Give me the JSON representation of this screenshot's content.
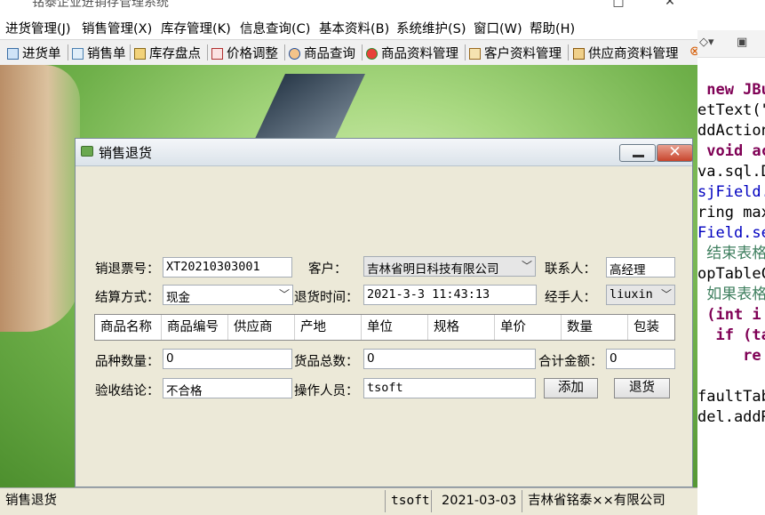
{
  "window": {
    "title": "铭泰企业进销存管理系统"
  },
  "menubar": {
    "items": [
      "进货管理(J)",
      "销售管理(X)",
      "库存管理(K)",
      "信息查询(C)",
      "基本资料(B)",
      "系统维护(S)",
      "窗口(W)",
      "帮助(H)"
    ]
  },
  "toolbar": {
    "items": [
      {
        "label": "进货单",
        "icon": "purchase-icon"
      },
      {
        "label": "销售单",
        "icon": "sales-icon"
      },
      {
        "label": "库存盘点",
        "icon": "inventory-icon"
      },
      {
        "label": "价格调整",
        "icon": "price-chart-icon"
      },
      {
        "label": "商品查询",
        "icon": "product-search-icon"
      },
      {
        "label": "商品资料管理",
        "icon": "product-data-icon"
      },
      {
        "label": "客户资料管理",
        "icon": "customer-icon"
      },
      {
        "label": "供应商资料管理",
        "icon": "supplier-icon"
      }
    ]
  },
  "dialog": {
    "title": "销售退货",
    "labels": {
      "ticket_no": "销退票号：",
      "customer": "客户：",
      "contact": "联系人：",
      "settlement": "结算方式：",
      "return_time": "退货时间：",
      "handler": "经手人：",
      "kinds": "品种数量：",
      "total_goods": "货品总数：",
      "total_amount": "合计金额：",
      "inspection": "验收结论：",
      "operator": "操作人员："
    },
    "values": {
      "ticket_no": "XT20210303001",
      "customer": "吉林省明日科技有限公司",
      "contact": "高经理",
      "settlement": "现金",
      "return_time": "2021-3-3 11:43:13",
      "handler": "liuxin",
      "kinds": "0",
      "total_goods": "0",
      "total_amount": "0",
      "inspection": "不合格",
      "operator": "tsoft"
    },
    "table_headers": [
      "商品名称",
      "商品编号",
      "供应商",
      "产地",
      "单位",
      "规格",
      "单价",
      "数量",
      "包装"
    ],
    "buttons": {
      "add": "添加",
      "return": "退货"
    }
  },
  "statusbar": {
    "current": "销售退货",
    "user": "tsoft",
    "date": "2021-03-03",
    "company": "吉林省铭泰××有限公司"
  },
  "ide_code": [
    {
      "k": "",
      "t": " new JBu"
    },
    {
      "k": "",
      "t": "etText(\""
    },
    {
      "k": "",
      "t": "ddAction"
    },
    {
      "k": "",
      "t": " void ac"
    },
    {
      "k": "",
      "t": "va.sql.D"
    },
    {
      "k": "",
      "t": "sjField."
    },
    {
      "k": "",
      "t": "ring max"
    },
    {
      "k": "",
      "t": "Field.se"
    },
    {
      "k": "",
      "t": " 结束表格"
    },
    {
      "k": "",
      "t": "opTableC"
    },
    {
      "k": "",
      "t": " 如果表格"
    },
    {
      "k": "",
      "t": " (int i"
    },
    {
      "k": "",
      "t": "  if (ta"
    },
    {
      "k": "",
      "t": "     re"
    },
    {
      "k": "",
      "t": ""
    },
    {
      "k": "",
      "t": "faultTab"
    },
    {
      "k": "",
      "t": "del.addR"
    }
  ],
  "colors": {
    "desktop_green": "#6fb04a",
    "dialog_bg": "#ece9d8",
    "close_red": "#c8452d"
  }
}
